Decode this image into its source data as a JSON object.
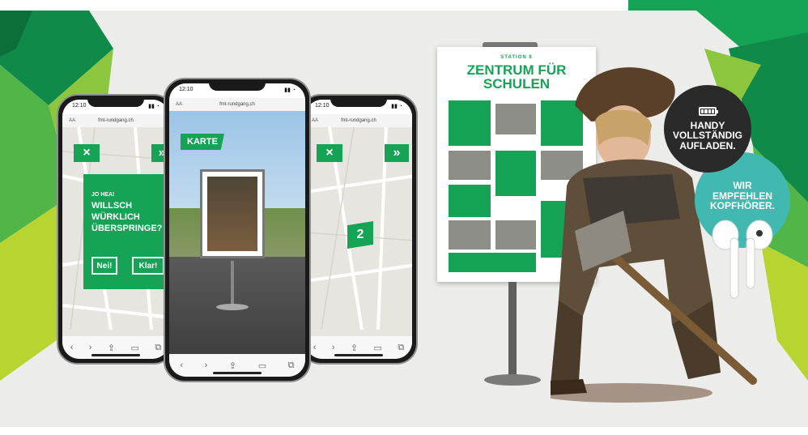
{
  "phone_left": {
    "status_time": "12:10",
    "url": "fmt-rundgang.ch",
    "close_glyph": "×",
    "next_glyph": "»",
    "prompt_lines": [
      "Jo hea!",
      "Willsch",
      "würklich",
      "überspringe?"
    ],
    "no_label": "Nei!",
    "yes_label": "Klar!"
  },
  "phone_center": {
    "status_time": "12:10",
    "url": "fmt-rundgang.ch",
    "map_label": "Karte"
  },
  "phone_right": {
    "status_time": "12:10",
    "url": "fmt-rundgang.ch",
    "close_glyph": "×",
    "next_glyph": "»",
    "station_number": "2"
  },
  "poster": {
    "kicker": "Station 8",
    "title_lines": [
      "Zentrum für",
      "Schulen"
    ]
  },
  "bubble_dark": {
    "icon": "battery-icon",
    "lines": [
      "Handy",
      "vollständig",
      "aufladen."
    ]
  },
  "bubble_teal": {
    "lines": [
      "Wir",
      "empfehlen",
      "Kopfhörer."
    ]
  },
  "colors": {
    "brand_green": "#16a355",
    "teal": "#41b8b0",
    "dark": "#2a2a2a",
    "background": "#ececea"
  }
}
